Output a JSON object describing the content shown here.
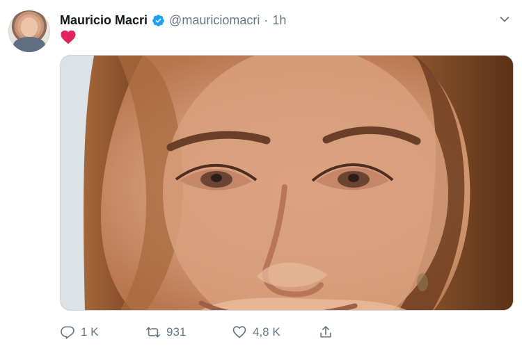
{
  "tweet": {
    "author_name": "Mauricio Macri",
    "author_handle": "@mauriciomacri",
    "separator": "·",
    "time": "1h",
    "content_icon": "heart-icon",
    "verified_icon": "verified-badge-icon",
    "more_icon": "chevron-down-icon"
  },
  "media": {
    "description": "close-up portrait image"
  },
  "actions": {
    "reply": {
      "icon": "reply-icon",
      "count": "1 K"
    },
    "retweet": {
      "icon": "retweet-icon",
      "count": "931"
    },
    "like": {
      "icon": "like-icon",
      "count": "4,8 K"
    },
    "share": {
      "icon": "share-icon"
    }
  },
  "colors": {
    "text": "#14171a",
    "muted": "#657786",
    "verified": "#1da1f2",
    "heart": "#e0245e",
    "border": "#ccd6dd"
  }
}
